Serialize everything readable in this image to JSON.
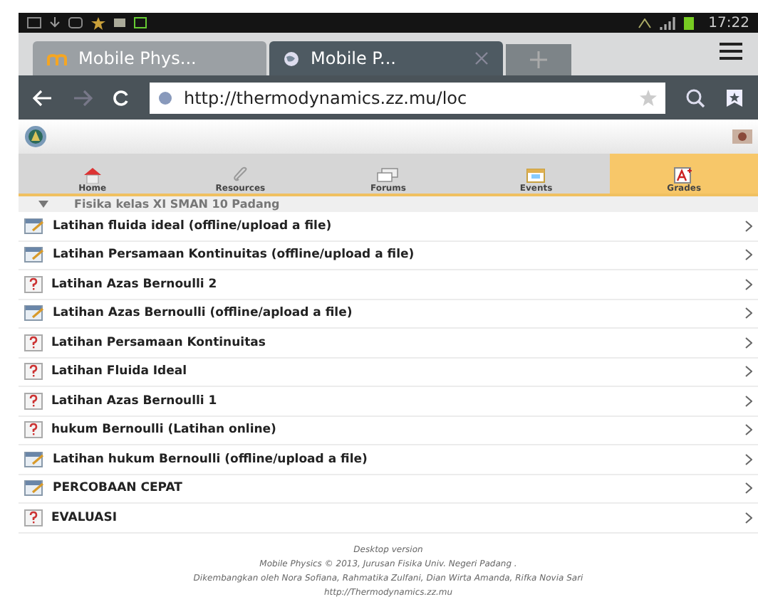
{
  "status_bar": {
    "time": "17:22"
  },
  "browser": {
    "tabs": [
      {
        "title": "Mobile Phys...",
        "selected": false,
        "kind": "moodle"
      },
      {
        "title": "Mobile P...",
        "selected": true,
        "kind": "globe"
      }
    ],
    "url": "http://thermodynamics.zz.mu/loc"
  },
  "nav": [
    {
      "label": "Home",
      "kind": "home",
      "selected": false
    },
    {
      "label": "Resources",
      "kind": "resources",
      "selected": false
    },
    {
      "label": "Forums",
      "kind": "forums",
      "selected": false
    },
    {
      "label": "Events",
      "kind": "events",
      "selected": false
    },
    {
      "label": "Grades",
      "kind": "grades",
      "selected": true
    }
  ],
  "section": {
    "title": "Fisika kelas XI SMAN 10 Padang",
    "expanded": true
  },
  "items": [
    {
      "title": "Latihan fluida ideal (offline/upload a file)",
      "kind": "assignment"
    },
    {
      "title": "Latihan Persamaan Kontinuitas (offline/upload a file)",
      "kind": "assignment"
    },
    {
      "title": "Latihan Azas Bernoulli 2",
      "kind": "quiz"
    },
    {
      "title": "Latihan Azas Bernoulli (offline/apload a file)",
      "kind": "assignment"
    },
    {
      "title": "Latihan Persamaan Kontinuitas",
      "kind": "quiz"
    },
    {
      "title": "Latihan Fluida Ideal",
      "kind": "quiz"
    },
    {
      "title": "Latihan Azas Bernoulli 1",
      "kind": "quiz"
    },
    {
      "title": "hukum Bernoulli (Latihan online)",
      "kind": "quiz"
    },
    {
      "title": "Latihan hukum Bernoulli (offline/upload a file)",
      "kind": "assignment"
    },
    {
      "title": "PERCOBAAN CEPAT",
      "kind": "assignment"
    },
    {
      "title": "EVALUASI",
      "kind": "quiz"
    }
  ],
  "footer": {
    "link": "Desktop version",
    "lines": [
      "Mobile Physics © 2013, Jurusan Fisika Univ. Negeri Padang .",
      "Dikembangkan oleh Nora Sofiana, Rahmatika Zulfani, Dian Wirta Amanda, Rifka Novia Sari",
      "http://Thermodynamics.zz.mu"
    ]
  }
}
